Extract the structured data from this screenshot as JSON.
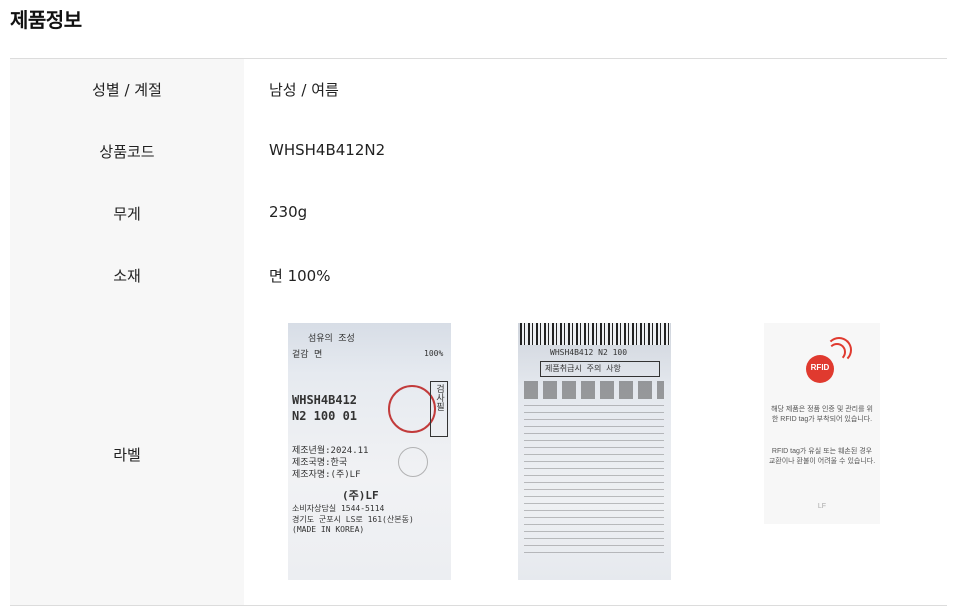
{
  "title": "제품정보",
  "rows": [
    {
      "label": "성별 / 계절",
      "value": "남성 / 여름"
    },
    {
      "label": "상품코드",
      "value": "WHSH4B412N2"
    },
    {
      "label": "무게",
      "value": "230g"
    },
    {
      "label": "소재",
      "value": "면 100%"
    },
    {
      "label": "라벨",
      "value": ""
    }
  ],
  "label_images": {
    "tag1": {
      "line1": "섬유의 조성",
      "line2": "겉감    면",
      "pct": "100%",
      "code1": "WHSH4B412",
      "code2": "N2 100 01",
      "made_date": "제조년월:2024.11",
      "origin": "제조국명:한국",
      "maker": "제조자명:(주)LF",
      "brand": "(주)LF",
      "cs": "소비자상담실 1544-5114",
      "address": "경기도 군포시 LS로 161(산본동)",
      "made_in": "(MADE IN KOREA)",
      "inspect": "검사필"
    },
    "tag2": {
      "code": "WHSH4B412 N2 100",
      "header": "제품취급시 주의 사항"
    },
    "tag3": {
      "badge": "RFID",
      "text1": "해당 제품은 정품 인증 및 관리를 위한 RFID tag가 부착되어 있습니다.",
      "text2": "RFID tag가 유실 또는 훼손된 경우 교환이나 환불이 어려울 수 있습니다.",
      "logo": "LF"
    }
  },
  "colors": {
    "header_bg": "#f7f7f7",
    "border": "#dcdcdc",
    "rfid_red": "#e03a2f"
  }
}
